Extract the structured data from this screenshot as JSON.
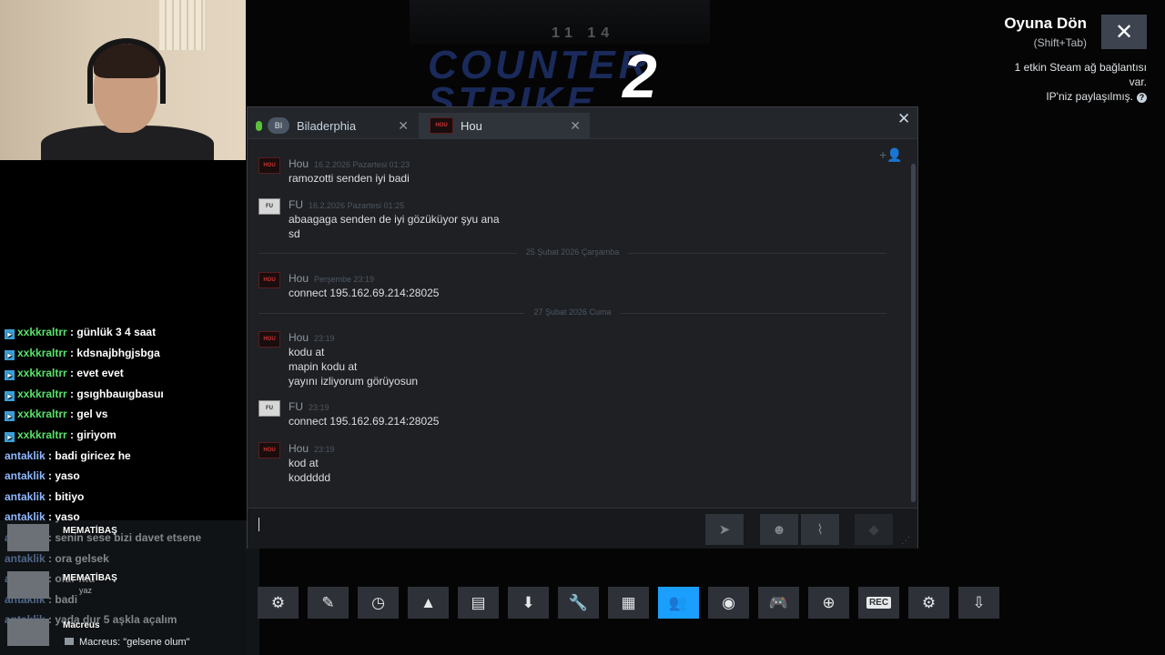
{
  "game": {
    "score_left": "11",
    "score_right": "14",
    "logo_text": "COUNTER STRIKE",
    "logo_number": "2"
  },
  "overlay": {
    "return_title": "Oyuna Dön",
    "return_hint": "(Shift+Tab)",
    "network_status_line1": "1 etkin Steam ağ bağlantısı",
    "network_status_line2": "var.",
    "ip_status": "IP'niz paylaşılmış.",
    "close_icon": "✕"
  },
  "chat_window": {
    "tabs": [
      {
        "label": "Biladerphia",
        "avatar": "BI"
      },
      {
        "label": "Hou",
        "avatar": "HOU"
      }
    ],
    "messages": [
      {
        "author": "Hou",
        "time": "16.2.2026 Pazartesi 01:23",
        "lines": [
          "ramozotti senden iyi badi"
        ]
      },
      {
        "author": "FU",
        "time": "16.2.2026 Pazartesi 01:25",
        "lines": [
          "abaagaga senden de iyi gözüküyor şyu ana",
          "sd"
        ]
      },
      {
        "author": "Hou",
        "time": "Perşembe 23:19",
        "lines": [
          "connect 195.162.69.214:28025"
        ]
      },
      {
        "author": "Hou",
        "time": "23:19",
        "lines": [
          "kodu at",
          "mapin kodu at",
          "yayını izliyorum görüyosun"
        ]
      },
      {
        "author": "FU",
        "time": "23:19",
        "lines": [
          "connect 195.162.69.214:28025"
        ]
      },
      {
        "author": "Hou",
        "time": "23:19",
        "lines": [
          "kod at",
          "koddddd"
        ]
      }
    ],
    "dividers": [
      "25 Şubat 2026 Çarşamba",
      "27 Şubat 2026 Cuma"
    ],
    "input_value": ""
  },
  "stream_chat": {
    "messages": [
      {
        "user": "xxkkraltrr",
        "text": "günlük 3 4 saat"
      },
      {
        "user": "xxkkraltrr",
        "text": "kdsnajbhgjsbga"
      },
      {
        "user": "xxkkraltrr",
        "text": "evet evet"
      },
      {
        "user": "xxkkraltrr",
        "text": "gsıghbauıgbasuı"
      },
      {
        "user": "xxkkraltrr",
        "text": "gel vs"
      },
      {
        "user": "xxkkraltrr",
        "text": "giriyom"
      },
      {
        "user": "antaklik",
        "text": "badi giricez he"
      },
      {
        "user": "antaklik",
        "text": "yaso"
      },
      {
        "user": "antaklik",
        "text": "bitiyo"
      },
      {
        "user": "antaklik",
        "text": "yaso"
      },
      {
        "user": "antaklik",
        "text": "senin sese bizi davet etsene"
      },
      {
        "user": "antaklik",
        "text": "ora gelsek"
      },
      {
        "user": "antaklik",
        "text": "olur mu"
      },
      {
        "user": "antaklik",
        "text": "badi"
      },
      {
        "user": "antaklik",
        "text": "yada dur 5 aşkla açalım"
      }
    ],
    "notifications": [
      {
        "name": "MEMATİBAŞ",
        "sub": ""
      },
      {
        "name": "MEMATİBAŞ",
        "sub": "yaz"
      },
      {
        "name": "Macreus",
        "sub": ""
      }
    ],
    "last_quote": "Macreus: \"gelsene olum\""
  },
  "toolbar": {
    "buttons": [
      {
        "name": "achievements",
        "icon": "⚙",
        "active": false
      },
      {
        "name": "notes",
        "icon": "✎",
        "active": false
      },
      {
        "name": "recent",
        "icon": "◷",
        "active": false
      },
      {
        "name": "screenshots",
        "icon": "▲",
        "active": false
      },
      {
        "name": "discussions",
        "icon": "▤",
        "active": false
      },
      {
        "name": "downloads",
        "icon": "⬇",
        "active": false
      },
      {
        "name": "settings-wrench",
        "icon": "🔧",
        "active": false
      },
      {
        "name": "media",
        "icon": "▦",
        "active": false
      },
      {
        "name": "friends",
        "icon": "👥",
        "active": true
      },
      {
        "name": "guides",
        "icon": "◉",
        "active": false
      },
      {
        "name": "controller",
        "icon": "🎮",
        "active": false,
        "dim": true
      },
      {
        "name": "web-browser",
        "icon": "⊕",
        "active": false
      },
      {
        "name": "recording",
        "icon": "REC",
        "active": false
      },
      {
        "name": "gear",
        "icon": "⚙",
        "active": false
      },
      {
        "name": "minimize",
        "icon": "⇩",
        "active": false
      }
    ]
  },
  "colors": {
    "accent": "#1a9fff",
    "friend_online": "#5cc13a",
    "stream_name_green": "#57e36a",
    "stream_name_blue": "#8fb8ff"
  }
}
